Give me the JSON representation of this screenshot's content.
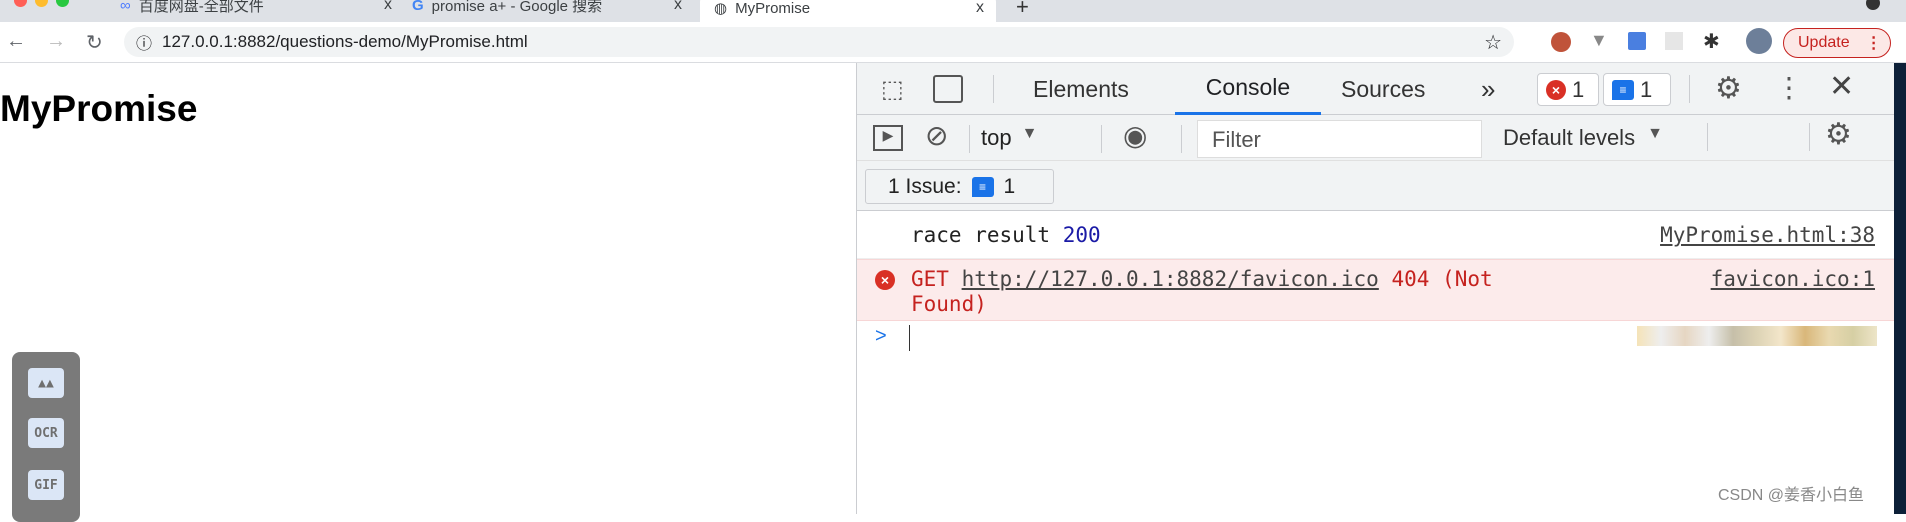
{
  "browser": {
    "tabs": [
      {
        "title": "百度网盘-全部文件"
      },
      {
        "title": "promise a+ - Google 搜索"
      },
      {
        "title": "MyPromise",
        "active": true
      }
    ],
    "tab_close": "x",
    "new_tab": "+",
    "url": "127.0.0.1:8882/questions-demo/MyPromise.html",
    "update_label": "Update"
  },
  "page": {
    "heading": "MyPromise"
  },
  "side_widget": {
    "buttons": [
      {
        "icon": "image-icon"
      },
      {
        "label": "OCR"
      },
      {
        "label": "GIF"
      }
    ]
  },
  "devtools": {
    "tabs": [
      "Elements",
      "Console",
      "Sources"
    ],
    "active_tab": "Console",
    "more": "»",
    "error_count": "1",
    "message_count": "1",
    "context": "top",
    "filter_placeholder": "Filter",
    "levels": "Default levels",
    "issues_label": "1 Issue:",
    "issues_count": "1",
    "logs": [
      {
        "type": "log",
        "text": "race result ",
        "value": "200",
        "source": "MyPromise.html:38"
      },
      {
        "type": "error",
        "method": "GET",
        "url": "http://127.0.0.1:8882/favicon.ico",
        "status": "404 (Not",
        "status2": "Found)",
        "source": "favicon.ico:1"
      }
    ],
    "prompt": ">"
  },
  "watermark": "CSDN @姜香小白鱼",
  "colors": {
    "accent": "#1a73e8",
    "error": "#c5221f",
    "error_bg": "#fcebeb",
    "number": "#1a1aa6"
  }
}
